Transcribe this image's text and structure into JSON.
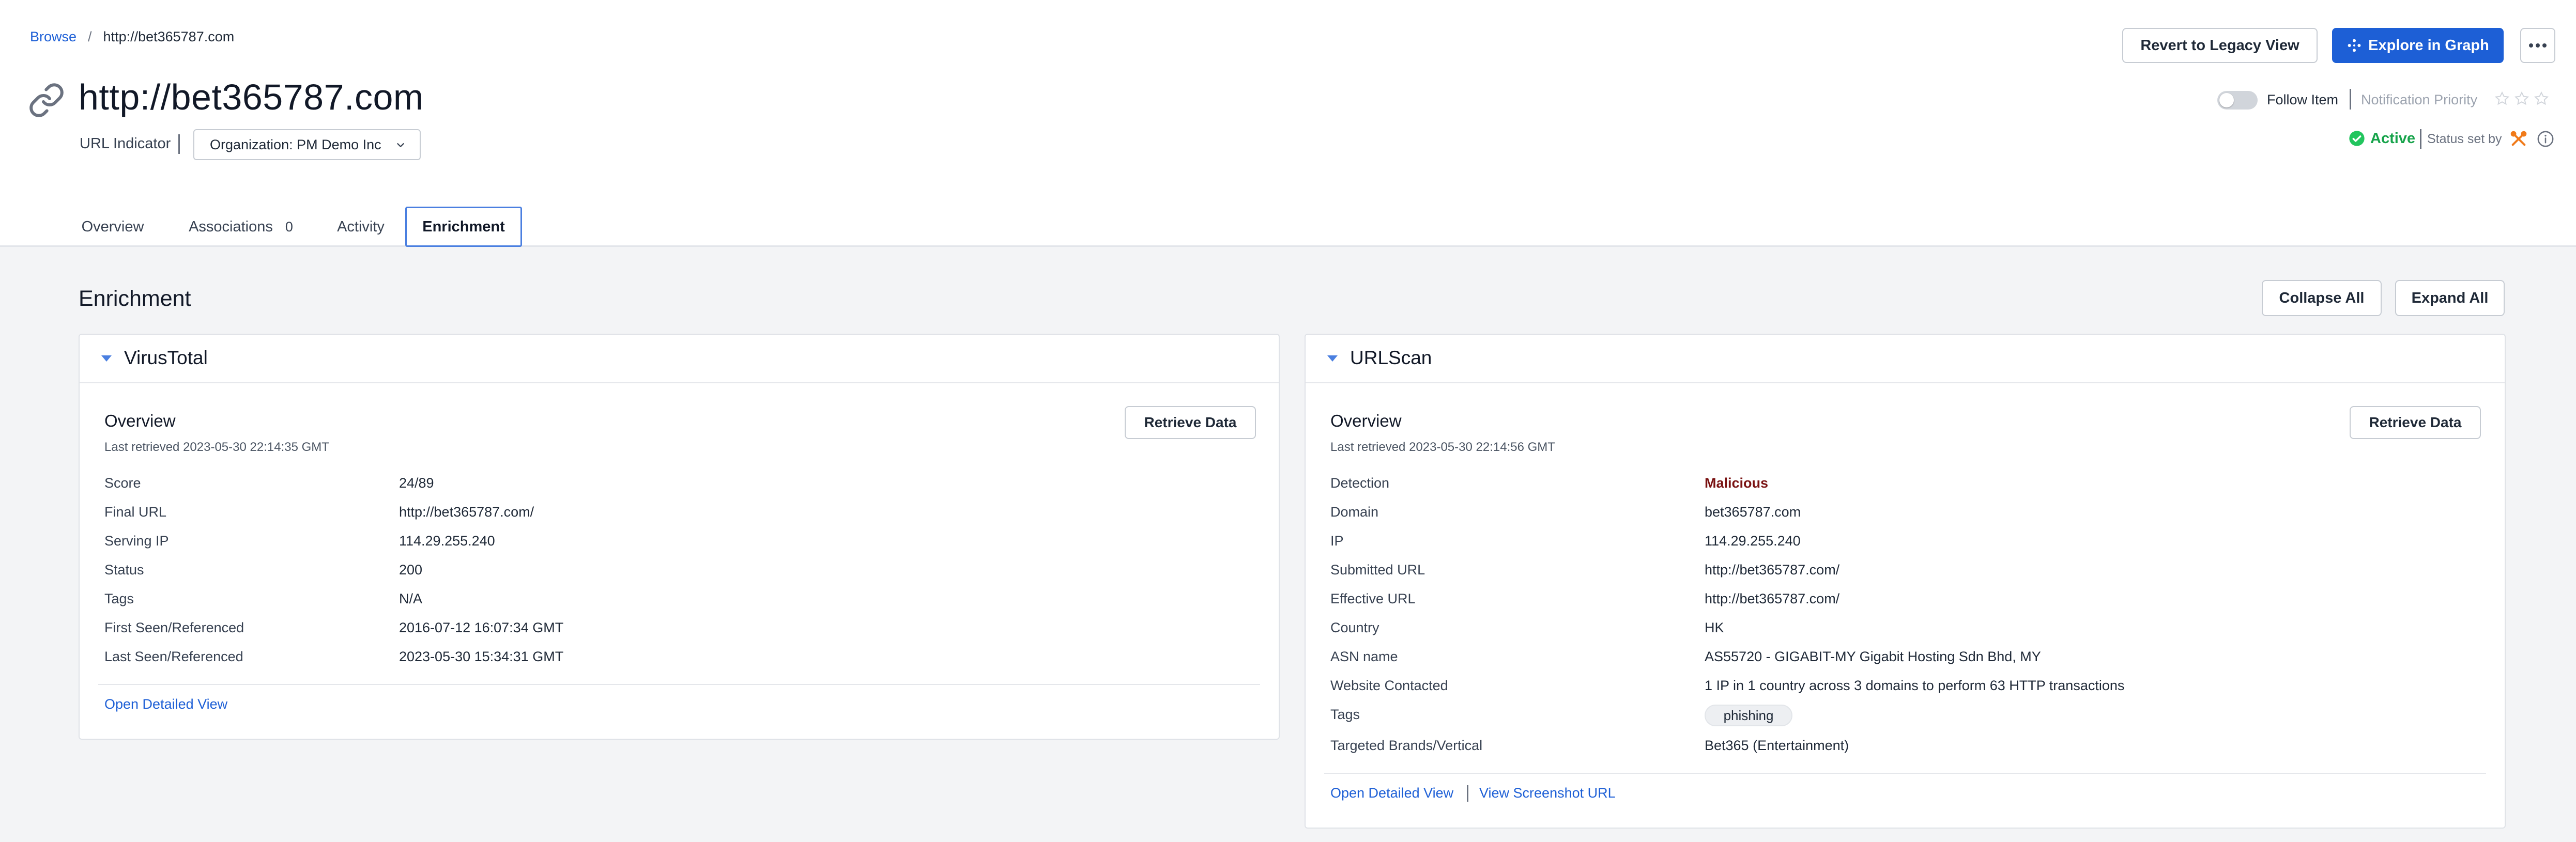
{
  "breadcrumb": {
    "root": "Browse",
    "separator": "/",
    "current": "http://bet365787.com"
  },
  "page": {
    "title": "http://bet365787.com",
    "type_label": "URL Indicator",
    "organization": "Organization: PM Demo Inc"
  },
  "actions": {
    "revert_label": "Revert to Legacy View",
    "explore_label": "Explore in Graph"
  },
  "follow": {
    "label": "Follow Item",
    "notification_label": "Notification Priority"
  },
  "status": {
    "value": "Active",
    "set_by_label": "Status set by"
  },
  "tabs": [
    {
      "label": "Overview"
    },
    {
      "label": "Associations",
      "count": "0"
    },
    {
      "label": "Activity"
    },
    {
      "label": "Enrichment"
    }
  ],
  "enrichment": {
    "title": "Enrichment",
    "collapse_all": "Collapse All",
    "expand_all": "Expand All"
  },
  "virustotal": {
    "title": "VirusTotal",
    "overview_title": "Overview",
    "last_retrieved": "Last retrieved 2023-05-30 22:14:35 GMT",
    "retrieve_label": "Retrieve Data",
    "rows": [
      {
        "label": "Score",
        "value": "24/89"
      },
      {
        "label": "Final URL",
        "value": "http://bet365787.com/"
      },
      {
        "label": "Serving IP",
        "value": "114.29.255.240"
      },
      {
        "label": "Status",
        "value": "200"
      },
      {
        "label": "Tags",
        "value": "N/A"
      },
      {
        "label": "First Seen/Referenced",
        "value": "2016-07-12 16:07:34 GMT"
      },
      {
        "label": "Last Seen/Referenced",
        "value": "2023-05-30 15:34:31 GMT"
      }
    ],
    "detail_link": "Open Detailed View"
  },
  "urlscan": {
    "title": "URLScan",
    "overview_title": "Overview",
    "last_retrieved": "Last retrieved 2023-05-30 22:14:56 GMT",
    "retrieve_label": "Retrieve Data",
    "rows": [
      {
        "label": "Detection",
        "value": "Malicious"
      },
      {
        "label": "Domain",
        "value": "bet365787.com"
      },
      {
        "label": "IP",
        "value": "114.29.255.240"
      },
      {
        "label": "Submitted URL",
        "value": "http://bet365787.com/"
      },
      {
        "label": "Effective URL",
        "value": "http://bet365787.com/"
      },
      {
        "label": "Country",
        "value": "HK"
      },
      {
        "label": "ASN name",
        "value": "AS55720 - GIGABIT-MY Gigabit Hosting Sdn Bhd, MY"
      },
      {
        "label": "Website Contacted",
        "value": "1 IP in 1 country across 3 domains to perform 63 HTTP transactions"
      },
      {
        "label": "Tags",
        "value": "phishing"
      },
      {
        "label": "Targeted Brands/Vertical",
        "value": "Bet365 (Entertainment)"
      }
    ],
    "detail_link": "Open Detailed View",
    "screenshot_link": "View Screenshot URL"
  },
  "colors": {
    "primary": "#1d5fd6",
    "active": "#16a34a",
    "malicious": "#7a1212",
    "background": "#f3f4f6"
  },
  "icons": [
    "link-icon",
    "chevron-down-icon",
    "graph-spark-icon",
    "more-dots-icon",
    "star-icon",
    "check-circle-icon",
    "tools-icon",
    "info-icon",
    "caret-down-icon"
  ]
}
